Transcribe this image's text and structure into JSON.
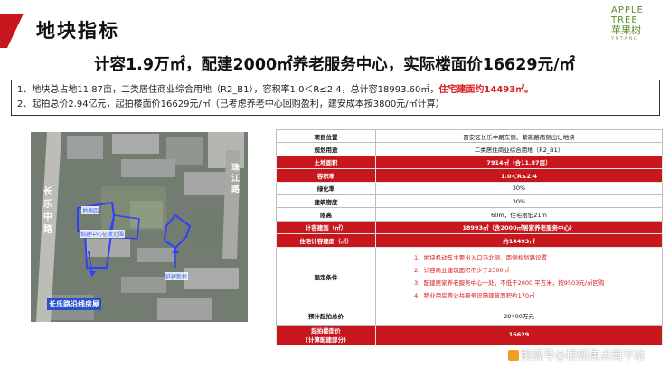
{
  "header": {
    "title": "地块指标",
    "logo": {
      "line1": "APPLE",
      "line2": "TREE",
      "cn": "苹果树",
      "sub": "Y·U·T·A·N·G"
    }
  },
  "headline": "计容1.9万㎡，配建2000㎡养老服务中心，实际楼面价16629元/㎡",
  "info": {
    "line1_prefix": "1、地块总占地11.87亩，二类居住商业综合用地（R2_B1），容积率1.0＜R≤2.4，总计容18993.60㎡，",
    "line1_highlight": "住宅建面约14493㎡。",
    "line2": "2、起拍总价2.94亿元，起拍楼面价16629元/㎡（已考虑养老中心回购盈利，建安成本按3800元/㎡计算）"
  },
  "map": {
    "label_road_left": "长乐中路",
    "label_road_right": "珠江路",
    "label_road_bottom": "长乐路沿线房屋",
    "label_parcel": "地块四",
    "label_area": "拟建中心征收范围",
    "label_village": "延建新村"
  },
  "table": {
    "rows": [
      {
        "key": "项目位置",
        "value": "晋安区长乐中路东侧、紫新路南侧出让地块",
        "style": "white"
      },
      {
        "key": "规划用途",
        "value": "二类居住商业综合用地（R2_B1）",
        "style": "white"
      },
      {
        "key": "土地面积",
        "value": "7914㎡（合11.87亩）",
        "style": "red"
      },
      {
        "key": "容积率",
        "value": "1.0＜R≤2.4",
        "style": "red"
      },
      {
        "key": "绿化率",
        "value": "30%",
        "style": "white"
      },
      {
        "key": "建筑密度",
        "value": "30%",
        "style": "white"
      },
      {
        "key": "限高",
        "value": "60m，住宅限低21m",
        "style": "white"
      },
      {
        "key": "计容建面（㎡）",
        "value": "18993㎡（含2000㎡居家养老服务中心）",
        "style": "red"
      },
      {
        "key": "住宅计容建面（㎡）",
        "value": "约14493㎡",
        "style": "red"
      }
    ],
    "conditions_key": "限定条件",
    "conditions": [
      "1、地块机动车主要出入口沿北侧、南侧规划路设置",
      "2、计容商业建筑面积不少于2300㎡",
      "3、配建居家养老服务中心一处，不低于2000 平方米，按9503元/㎡回购",
      "4、物业用房等公共服务设施建筑面积约170㎡"
    ],
    "price_key": "预计起拍总价",
    "price_value": "29400万元",
    "floor_key_1": "起拍楼面价",
    "floor_key_2": "(计算配建部分)",
    "floor_value": "16629"
  },
  "watermark": "搜狐号@搜狐焦点南平站",
  "colors": {
    "accent": "#c8161d",
    "highlight": "#d81a1a",
    "brand_green": "#5a8a2a"
  }
}
